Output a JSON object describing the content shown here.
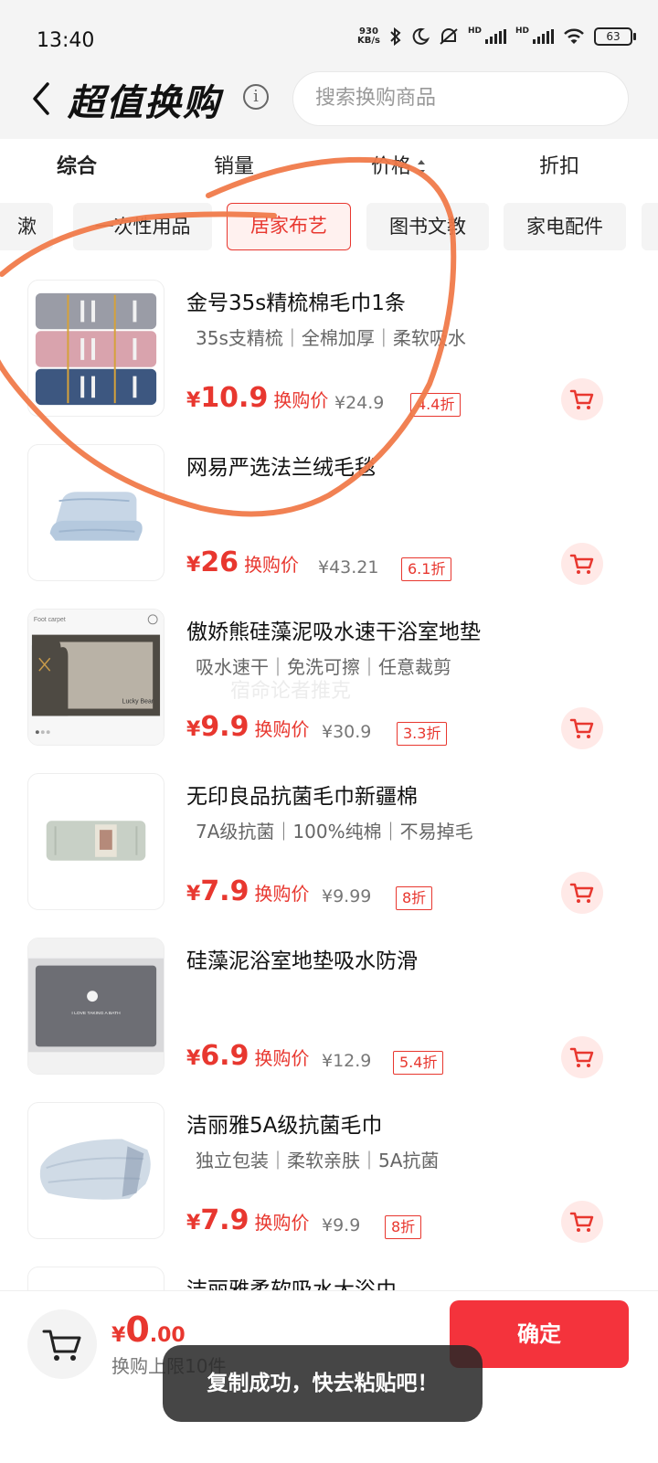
{
  "status_bar": {
    "time": "13:40",
    "net_speed_value": "930",
    "net_speed_unit": "KB/s",
    "hd_label": "HD",
    "battery": "63",
    "icons": [
      "bluetooth-icon",
      "moon-icon",
      "mute-icon",
      "signal-icon",
      "signal-icon",
      "wifi-icon",
      "battery-icon"
    ]
  },
  "header": {
    "title": "超值换购",
    "info_icon": "info-icon",
    "search_placeholder": "搜索换购商品"
  },
  "sort_tabs": [
    {
      "label": "综合",
      "active": true
    },
    {
      "label": "销量",
      "active": false
    },
    {
      "label": "价格",
      "active": false
    },
    {
      "label": "折扣",
      "active": false
    }
  ],
  "categories": [
    {
      "label": "漱",
      "active": false
    },
    {
      "label": "一次性用品",
      "active": false
    },
    {
      "label": "居家布艺",
      "active": true
    },
    {
      "label": "图书文教",
      "active": false
    },
    {
      "label": "家电配件",
      "active": false
    }
  ],
  "products": [
    {
      "title": "金号35s精梳棉毛巾1条",
      "tags": "35s支精梳｜全棉加厚｜柔软吸水",
      "price": "10.9",
      "price_label": "换购价",
      "original_price": "¥24.9",
      "discount": "4.4折"
    },
    {
      "title": "网易严选法兰绒毛毯",
      "tags": "",
      "price": "26",
      "price_label": "换购价",
      "original_price": "¥43.21",
      "discount": "6.1折"
    },
    {
      "title": "傲娇熊硅藻泥吸水速干浴室地垫",
      "tags": "吸水速干｜免洗可擦｜任意裁剪",
      "price": "9.9",
      "price_label": "换购价",
      "original_price": "¥30.9",
      "discount": "3.3折",
      "image_text": {
        "top": "Foot carpet",
        "brand": "Lucky Bear"
      }
    },
    {
      "title": "无印良品抗菌毛巾新疆棉",
      "tags": "7A级抗菌｜100%纯棉｜不易掉毛",
      "price": "7.9",
      "price_label": "换购价",
      "original_price": "¥9.99",
      "discount": "8折"
    },
    {
      "title": "硅藻泥浴室地垫吸水防滑",
      "tags": "",
      "price": "6.9",
      "price_label": "换购价",
      "original_price": "¥12.9",
      "discount": "5.4折",
      "image_text": {
        "mat": "I LOVE TAKING A BATH"
      }
    },
    {
      "title": "洁丽雅5A级抗菌毛巾",
      "tags": "独立包装｜柔软亲肤｜5A抗菌",
      "price": "7.9",
      "price_label": "换购价",
      "original_price": "¥9.9",
      "discount": "8折"
    },
    {
      "title": "洁丽雅柔软吸水大浴巾",
      "tags": "",
      "price": "",
      "price_label": "",
      "original_price": "",
      "discount": ""
    }
  ],
  "currency": "¥",
  "bottom_bar": {
    "total_int": "0",
    "total_dec": ".00",
    "limit_text": "换购上限10件",
    "confirm_label": "确定"
  },
  "toast": "复制成功，快去粘贴吧！",
  "watermark": "宿命论者推克",
  "colors": {
    "accent": "#e8372f",
    "confirm": "#f4333c",
    "annotation": "#f07a4a"
  }
}
